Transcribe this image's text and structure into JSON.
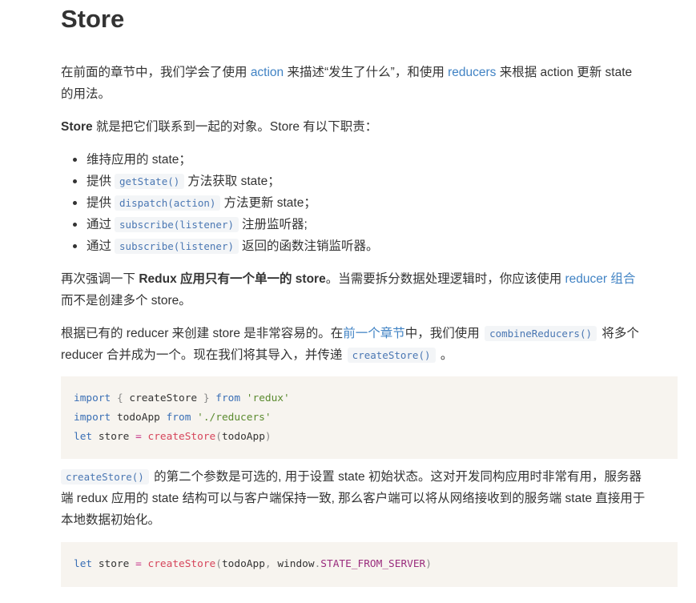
{
  "title": "Store",
  "p1": {
    "t1": "在前面的章节中，我们学会了使用 ",
    "link_action": "action",
    "t2": " 来描述“发生了什么”，和使用 ",
    "link_reducers": "reducers",
    "t3": " 来根据 action 更新 state",
    "t4": "的用法。"
  },
  "p2": {
    "bold": "Store",
    "t1": " 就是把它们联系到一起的对象。Store 有以下职责："
  },
  "list": [
    {
      "pre": "维持应用的 state；",
      "code": "",
      "post": ""
    },
    {
      "pre": "提供",
      "code": "getState()",
      "post": "方法获取 state；"
    },
    {
      "pre": "提供",
      "code": "dispatch(action)",
      "post": "方法更新 state；"
    },
    {
      "pre": "通过",
      "code": "subscribe(listener)",
      "post": "注册监听器;"
    },
    {
      "pre": "通过",
      "code": "subscribe(listener)",
      "post": "返回的函数注销监听器。"
    }
  ],
  "p3": {
    "t1": "再次强调一下 ",
    "bold": "Redux 应用只有一个单一的 store",
    "t2": "。当需要拆分数据处理逻辑时，你应该使用 ",
    "link": "reducer 组合",
    "t3": "而不是创建多个 store。"
  },
  "p4": {
    "t1": "根据已有的 reducer 来创建 store 是非常容易的。在",
    "link": "前一个章节",
    "t2": "中，我们使用 ",
    "code1": "combineReducers()",
    "t3": " 将多个",
    "t4": "reducer 合并成为一个。现在我们将其导入，并传递 ",
    "code2": "createStore()",
    "t5": " 。"
  },
  "code1": {
    "line1": {
      "kw1": "import",
      "p1": " { ",
      "name": "createStore",
      "p2": " } ",
      "kw2": "from",
      "str": "'redux'"
    },
    "line2": {
      "kw1": "import",
      "name": " todoApp ",
      "kw2": "from",
      "str": "'./reducers'"
    },
    "line3": {
      "kw": "let",
      "name": " store ",
      "op": "=",
      "fn": "createStore",
      "p1": "(",
      "arg": "todoApp",
      "p2": ")"
    }
  },
  "p5": {
    "code": "createStore()",
    "t1": " 的第二个参数是可选的, 用于设置 state 初始状态。这对开发同构应用时非常有用，服务器",
    "t2": "端 redux 应用的 state 结构可以与客户端保持一致, 那么客户端可以将从网络接收到的服务端 state 直接用于",
    "t3": "本地数据初始化。"
  },
  "code2": {
    "kw": "let",
    "name": " store ",
    "op": "=",
    "fn": "createStore",
    "p1": "(",
    "arg1": "todoApp",
    "comma": ", ",
    "obj": "window",
    "dot": ".",
    "const": "STATE_FROM_SERVER",
    "p2": ")"
  }
}
